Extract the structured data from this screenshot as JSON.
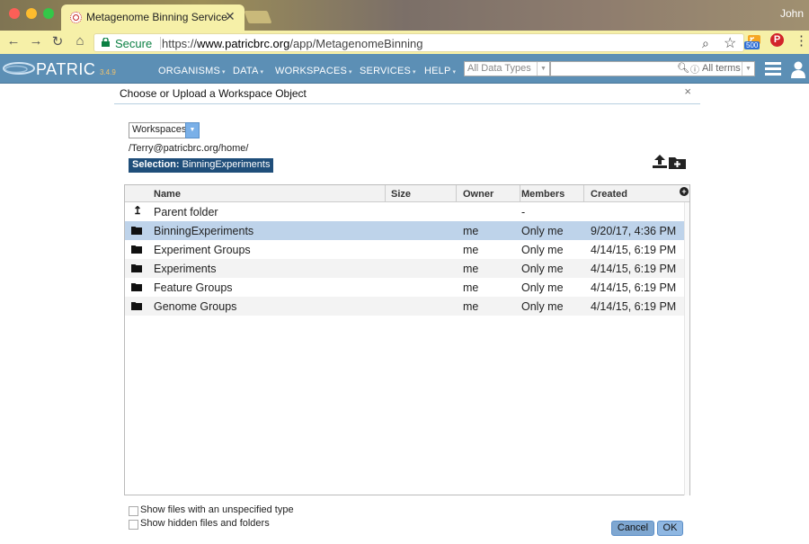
{
  "browser": {
    "tab_title": "Metagenome Binning Service",
    "user": "John",
    "secure_label": "Secure",
    "url_scheme": "https://",
    "url_domain": "www.patricbrc.org",
    "url_path": "/app/MetagenomeBinning",
    "ext_badge": "500"
  },
  "site": {
    "logo": "PATRIC",
    "version": "3.4.9",
    "nav": [
      "ORGANISMS",
      "DATA",
      "WORKSPACES",
      "SERVICES",
      "HELP"
    ],
    "data_type_select": "All Data Types",
    "search_scope": "All terms"
  },
  "dialog": {
    "title": "Choose or Upload a Workspace Object",
    "close": "×",
    "source_select": "Workspaces",
    "path": "/Terry@patricbrc.org/home/",
    "selection_label": "Selection:",
    "selection_value": "BinningExperiments",
    "columns": [
      "Name",
      "Size",
      "Owner",
      "Members",
      "Created"
    ],
    "parent_row": {
      "name": "Parent folder",
      "members": "-"
    },
    "rows": [
      {
        "name": "BinningExperiments",
        "size": "",
        "owner": "me",
        "members": "Only me",
        "created": "9/20/17, 4:36 PM"
      },
      {
        "name": "Experiment Groups",
        "size": "",
        "owner": "me",
        "members": "Only me",
        "created": "4/14/15, 6:19 PM"
      },
      {
        "name": "Experiments",
        "size": "",
        "owner": "me",
        "members": "Only me",
        "created": "4/14/15, 6:19 PM"
      },
      {
        "name": "Feature Groups",
        "size": "",
        "owner": "me",
        "members": "Only me",
        "created": "4/14/15, 6:19 PM"
      },
      {
        "name": "Genome Groups",
        "size": "",
        "owner": "me",
        "members": "Only me",
        "created": "4/14/15, 6:19 PM"
      }
    ],
    "option_unspecified": "Show files with an unspecified type",
    "option_hidden": "Show hidden files and folders",
    "cancel_label": "Cancel",
    "ok_label": "OK"
  }
}
